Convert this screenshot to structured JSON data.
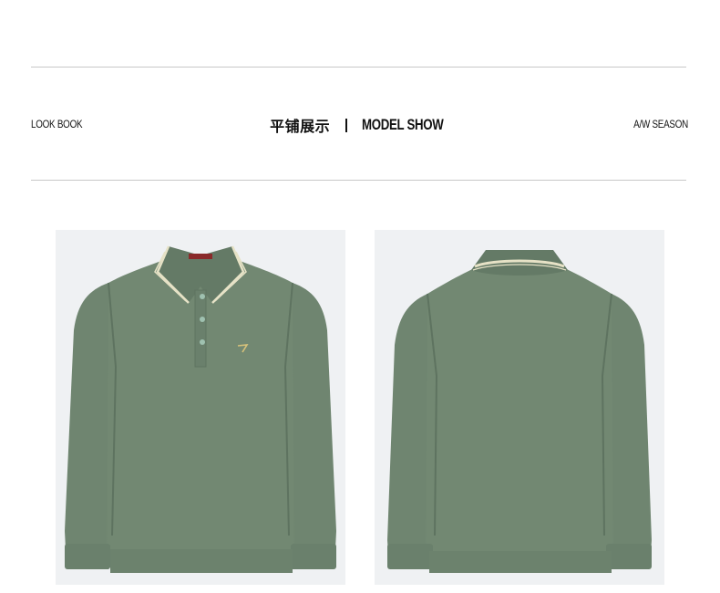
{
  "header": {
    "left_label": "LOOK BOOK",
    "center_cn": "平铺展示",
    "center_en": "MODEL SHOW",
    "right_label": "A/W SEASON"
  },
  "colors": {
    "shirt": "#6f8570",
    "shirt_shadow": "#5e7360",
    "collar_stripe": "#e6e2c6",
    "panel_bg": "#eff1f3",
    "rule": "#c8c8c8"
  },
  "images": [
    {
      "name": "polo-front-image",
      "view": "front"
    },
    {
      "name": "polo-back-image",
      "view": "back"
    }
  ]
}
